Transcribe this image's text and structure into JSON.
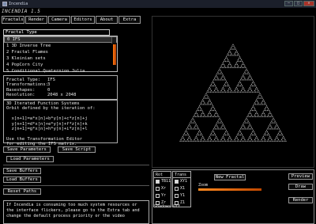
{
  "window": {
    "title": "Incendia",
    "buttons": [
      "–",
      "□",
      "✕"
    ]
  },
  "app": {
    "name": "INCENDIA 1.5"
  },
  "menu": [
    "Fractals",
    "Render",
    "Camera",
    "Editors",
    "About",
    "Extra"
  ],
  "fractal_type_label": "Fractal Type",
  "fractal_list": [
    "0 IFS",
    "1 3D Inverse Tree",
    "2 Fractal Flames",
    "3 Kleinian sets",
    "4 PopCorn City",
    "5 Conditional Quaternion Julia"
  ],
  "info": {
    "type_label": "Fractal Type:",
    "type_value": "IFS",
    "transformations_label": "Transformations:",
    "transformations_value": "3",
    "baseshapes_label": "Baseshapes:",
    "baseshapes_value": "0",
    "resolution_label": "Resolution:",
    "resolution_value": "2048 x 2048"
  },
  "description": "3D Iterated Function Systems\nOrbit defined by the iteration of:\n\n  x[n+1]=a*x[n]+b*y[n]+c*z[n]+j\n  y[n+1]=d*x[n]+e*y[n]+f*z[n]+k\n  z[n+1]=g*x[n]+h*y[n]+i*z[n]+l\n\nUse the Transformation Editor\nfor editing the IFS matrix.",
  "buttons": {
    "save_parameters": "Save Parameters",
    "save_script": "Save Script",
    "load_parameters": "Load Parameters",
    "save_buffers": "Save Buffers",
    "load_buffers": "Load Buffers",
    "reset_paths": "Reset Paths"
  },
  "message": "If Incendia is consuming too much system resources or the interface flickers, please go to the Extra tab and change the default process priority or the video",
  "controls": {
    "rot": {
      "header": "Rot",
      "items": [
        {
          "label": "TB11",
          "on": true
        },
        {
          "label": "Xr",
          "on": false
        },
        {
          "label": "Yr",
          "on": false
        },
        {
          "label": "Zr",
          "on": false
        }
      ]
    },
    "trans": {
      "header": "Trans",
      "items": [
        {
          "label": "XY1",
          "on": true
        },
        {
          "label": "X1",
          "on": false
        },
        {
          "label": "Y1",
          "on": false
        },
        {
          "label": "Z1",
          "on": false
        }
      ]
    },
    "shadows": "Shadows Off",
    "new_fractal": "New Fractal",
    "zoom_label": "Zoom",
    "preview": "Preview",
    "draw": "Draw",
    "render": "Render"
  },
  "colors": {
    "accent": "#ff7a10",
    "fractal": "#cfcfcf"
  }
}
